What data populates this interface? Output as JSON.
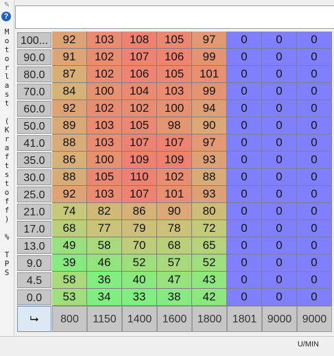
{
  "axis_label_chars": [
    "M",
    "o",
    "t",
    "o",
    "r",
    "l",
    "a",
    "s",
    "t",
    " ",
    "(",
    "K",
    "r",
    "a",
    "f",
    "t",
    "s",
    "t",
    "o",
    "f",
    "f",
    ")",
    " ",
    "%",
    " ",
    "T",
    "P",
    "S"
  ],
  "rows": [
    {
      "label": "100...",
      "values": [
        92,
        103,
        108,
        105,
        97,
        0,
        0,
        0
      ]
    },
    {
      "label": "90.0",
      "values": [
        91,
        102,
        107,
        106,
        99,
        0,
        0,
        0
      ]
    },
    {
      "label": "80.0",
      "values": [
        87,
        102,
        106,
        105,
        101,
        0,
        0,
        0
      ]
    },
    {
      "label": "70.0",
      "values": [
        84,
        100,
        104,
        103,
        99,
        0,
        0,
        0
      ]
    },
    {
      "label": "60.0",
      "values": [
        92,
        102,
        102,
        100,
        94,
        0,
        0,
        0
      ]
    },
    {
      "label": "50.0",
      "values": [
        89,
        103,
        105,
        98,
        90,
        0,
        0,
        0
      ]
    },
    {
      "label": "41.0",
      "values": [
        88,
        103,
        107,
        107,
        97,
        0,
        0,
        0
      ]
    },
    {
      "label": "35.0",
      "values": [
        86,
        100,
        109,
        109,
        93,
        0,
        0,
        0
      ]
    },
    {
      "label": "30.0",
      "values": [
        88,
        105,
        110,
        102,
        88,
        0,
        0,
        0
      ]
    },
    {
      "label": "25.0",
      "values": [
        92,
        103,
        107,
        101,
        93,
        0,
        0,
        0
      ]
    },
    {
      "label": "21.0",
      "values": [
        74,
        82,
        86,
        90,
        80,
        0,
        0,
        0
      ]
    },
    {
      "label": "17.0",
      "values": [
        68,
        77,
        79,
        78,
        72,
        0,
        0,
        0
      ]
    },
    {
      "label": "13.0",
      "values": [
        49,
        58,
        70,
        68,
        65,
        0,
        0,
        0
      ]
    },
    {
      "label": "9.0",
      "values": [
        39,
        46,
        52,
        57,
        52,
        0,
        0,
        0
      ]
    },
    {
      "label": "4.5",
      "values": [
        58,
        36,
        40,
        47,
        43,
        0,
        0,
        0
      ]
    },
    {
      "label": "0.0",
      "values": [
        53,
        34,
        33,
        38,
        42,
        0,
        0,
        0
      ]
    }
  ],
  "columns": [
    "800",
    "1150",
    "1400",
    "1600",
    "1800",
    "1801",
    "9000",
    "9000"
  ],
  "corner_symbol": "⮡",
  "unit_label": "U/MIN",
  "colors": {
    "zero": "#8080ff",
    "low": "#80ee80",
    "mid": "#c8c87a",
    "high": "#f08070"
  }
}
